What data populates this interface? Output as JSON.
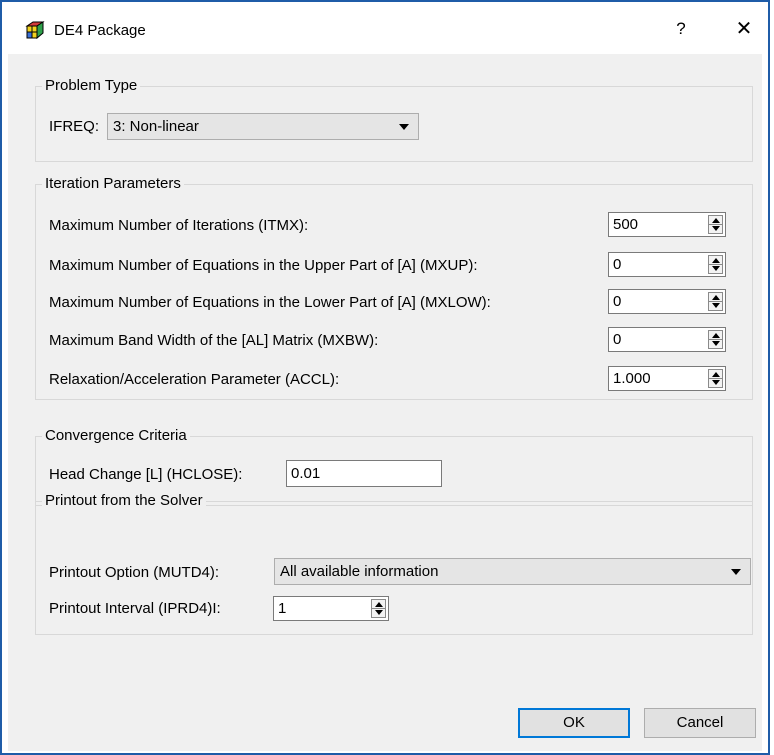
{
  "title": "DE4 Package",
  "titlebar": {
    "help": "?",
    "close": "✕"
  },
  "problem_type": {
    "group_label": "Problem Type",
    "ifreq_label": "IFREQ:",
    "ifreq_value": "3: Non-linear"
  },
  "iteration": {
    "group_label": "Iteration Parameters",
    "rows": [
      {
        "label": "Maximum Number of Iterations (ITMX):",
        "value": "500"
      },
      {
        "label": "Maximum Number of Equations in the Upper Part of [A] (MXUP):",
        "value": "0"
      },
      {
        "label": "Maximum Number of Equations in the Lower Part of [A] (MXLOW):",
        "value": "0"
      },
      {
        "label": "Maximum Band Width of the [AL] Matrix (MXBW):",
        "value": "0"
      },
      {
        "label": "Relaxation/Acceleration Parameter (ACCL):",
        "value": "1.000"
      }
    ]
  },
  "convergence": {
    "group_label": "Convergence Criteria",
    "hclose_label": "Head Change [L] (HCLOSE):",
    "hclose_value": "0.01"
  },
  "printout": {
    "group_label": "Printout from the Solver",
    "option_label": "Printout Option (MUTD4):",
    "option_value": "All available information",
    "interval_label": "Printout Interval (IPRD4)I:",
    "interval_value": "1"
  },
  "buttons": {
    "ok": "OK",
    "cancel": "Cancel"
  }
}
